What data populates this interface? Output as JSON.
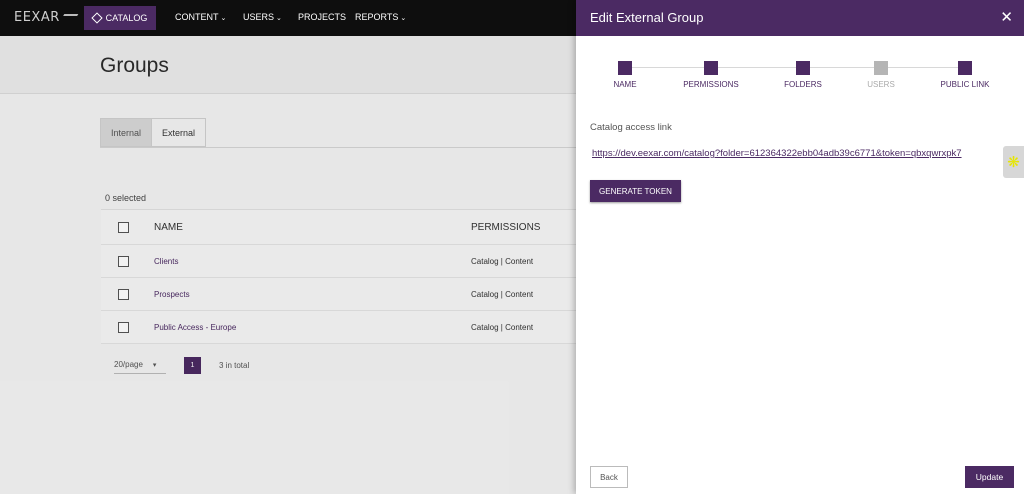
{
  "nav": {
    "logo": "EEXAR",
    "catalog": "CATALOG",
    "content": "CONTENT",
    "users": "USERS",
    "projects": "PROJECTS",
    "reports": "REPORTS"
  },
  "page": {
    "title": "Groups",
    "tabs": [
      "Internal",
      "External"
    ],
    "active_tab": "External",
    "selected_count": "0 selected"
  },
  "table": {
    "columns": [
      "NAME",
      "PERMISSIONS"
    ],
    "rows": [
      {
        "name": "Clients",
        "permissions": "Catalog | Content"
      },
      {
        "name": "Prospects",
        "permissions": "Catalog | Content"
      },
      {
        "name": "Public Access - Europe",
        "permissions": "Catalog | Content"
      }
    ]
  },
  "pagination": {
    "page_size": "20/page",
    "current_page": "1",
    "total": "3 in total"
  },
  "drawer": {
    "title": "Edit External Group",
    "steps": [
      {
        "label": "NAME",
        "active": true
      },
      {
        "label": "PERMISSIONS",
        "active": true
      },
      {
        "label": "FOLDERS",
        "active": true
      },
      {
        "label": "USERS",
        "active": false
      },
      {
        "label": "PUBLIC LINK",
        "active": true
      }
    ],
    "access_label": "Catalog access link",
    "access_link": "https://dev.eexar.com/catalog?folder=612364322ebb04adb39c6771&token=qbxqwrxpk7",
    "generate_token": "GENERATE TOKEN",
    "back": "Back",
    "update": "Update"
  },
  "colors": {
    "accent": "#4b2a63",
    "nav_bg": "#0e0e0e",
    "inactive_step": "#b5b5b5"
  }
}
